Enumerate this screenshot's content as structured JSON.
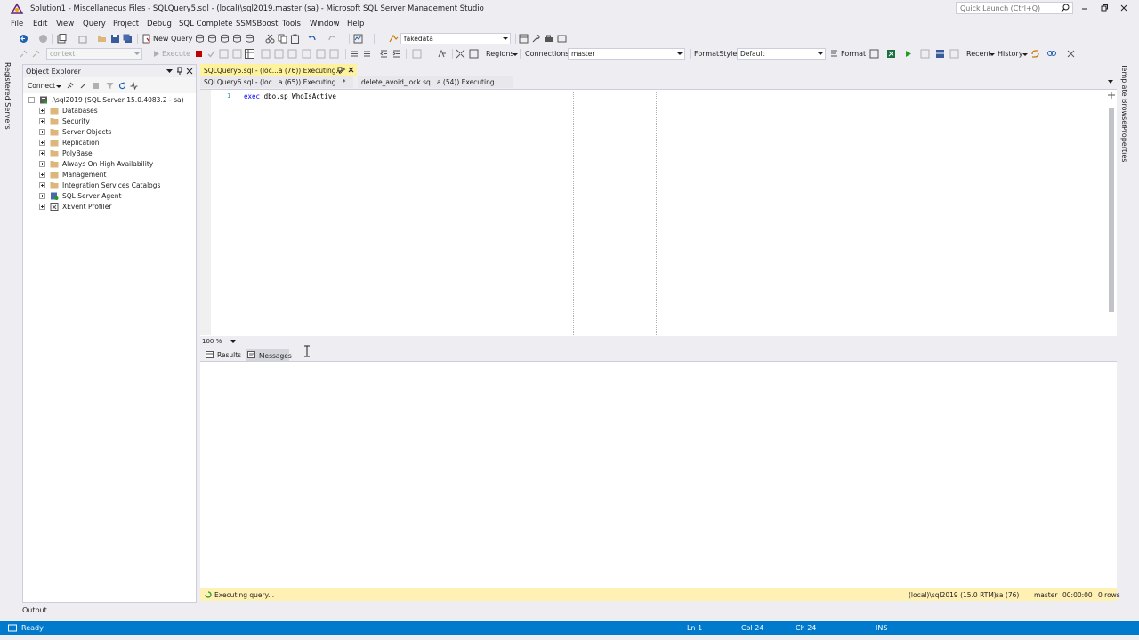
{
  "window": {
    "title": "Solution1 - Miscellaneous Files - SQLQuery5.sql - (local)\\sql2019.master (sa) - Microsoft SQL Server Management Studio",
    "quick_launch_placeholder": "Quick Launch (Ctrl+Q)"
  },
  "menu": [
    "File",
    "Edit",
    "View",
    "Query",
    "Project",
    "Debug",
    "SQL Complete",
    "SSMSBoost",
    "Tools",
    "Window",
    "Help"
  ],
  "toolbar1": {
    "new_query_label": "New Query",
    "database_value": "fakedata"
  },
  "toolbar2": {
    "context_value": "context",
    "execute_label": "Execute",
    "regions_label": "Regions",
    "connections_label": "Connections",
    "connections_value": "master",
    "formatstyles_label": "FormatStyles",
    "formatstyles_value": "Default",
    "format_label": "Format",
    "recent_label": "Recent",
    "history_label": "History"
  },
  "left_rail": {
    "registered_servers": "Registered Servers"
  },
  "object_explorer": {
    "title": "Object Explorer",
    "connect_label": "Connect",
    "server_node": ".\\sql2019 (SQL Server 15.0.4083.2 - sa)",
    "nodes": [
      "Databases",
      "Security",
      "Server Objects",
      "Replication",
      "PolyBase",
      "Always On High Availability",
      "Management",
      "Integration Services Catalogs",
      "SQL Server Agent",
      "XEvent Profiler"
    ]
  },
  "doc_tabs": {
    "active": "SQLQuery5.sql - (loc...a (76)) Executing...*",
    "tab2": "SQLQuery6.sql - (loc...a (65)) Executing...*",
    "tab3": "delete_avoid_lock.sq...a (54)) Executing..."
  },
  "editor": {
    "line_number": "1",
    "code_keyword": "exec",
    "code_object": " dbo.sp_WhoIsActive"
  },
  "zoom": "100 %",
  "results_tabs": {
    "results": "Results",
    "messages": "Messages"
  },
  "exec_status": {
    "message": "Executing query...",
    "server": "(local)\\sql2019 (15.0 RTM)",
    "user": "sa (76)",
    "database": "master",
    "elapsed": "00:00:00",
    "rows": "0 rows"
  },
  "right_rail": {
    "template_browser": "Template Browser",
    "properties": "Properties"
  },
  "output_label": "Output",
  "statusbar": {
    "ready": "Ready",
    "ln": "Ln 1",
    "col": "Col 24",
    "ch": "Ch 24",
    "ins": "INS"
  },
  "colors": {
    "accent_blue": "#007acc",
    "active_tab_yellow": "#fff29d",
    "exec_status_yellow": "#fff1b3",
    "folder": "#dcb67a"
  }
}
